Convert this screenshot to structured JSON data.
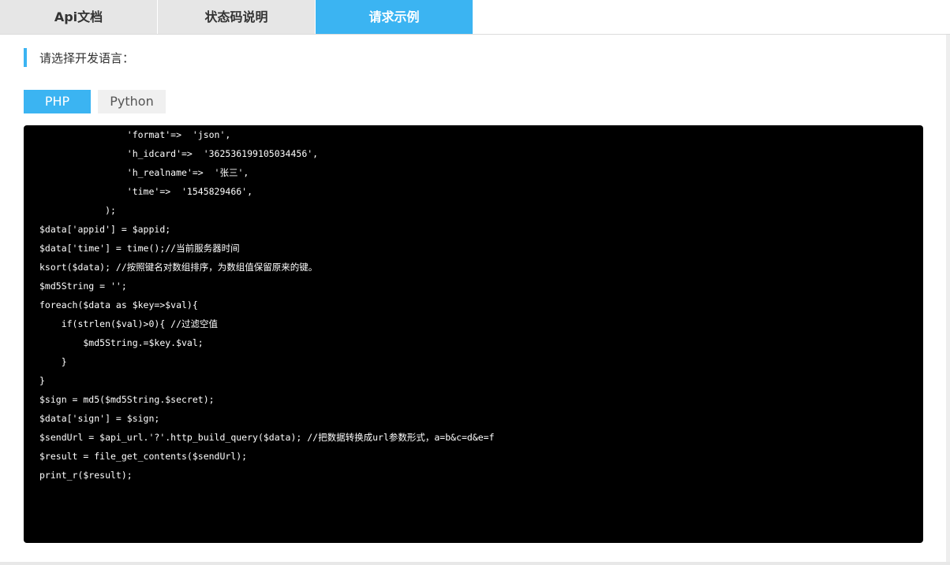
{
  "tabs": [
    {
      "label": "Api文档"
    },
    {
      "label": "状态码说明"
    },
    {
      "label": "请求示例",
      "active": true
    }
  ],
  "section_label": "请选择开发语言：",
  "languages": {
    "php": "PHP",
    "python": "Python",
    "selected": "PHP"
  },
  "code_lines": [
    "                'format'=>  'json',",
    "                'h_idcard'=>  '362536199105034456',",
    "                'h_realname'=>  '张三',",
    "                'time'=>  '1545829466',",
    "            );",
    "$data['appid'] = $appid;",
    "$data['time'] = time();//当前服务器时间",
    "ksort($data); //按照键名对数组排序，为数组值保留原来的键。",
    "$md5String = '';",
    "foreach($data as $key=>$val){",
    "    if(strlen($val)>0){ //过滤空值",
    "        $md5String.=$key.$val;",
    "    }",
    "}",
    "$sign = md5($md5String.$secret);",
    "$data['sign'] = $sign;",
    "$sendUrl = $api_url.'?'.http_build_query($data); //把数据转换成url参数形式，a=b&c=d&e=f",
    "$result = file_get_contents($sendUrl);",
    "print_r($result);"
  ],
  "colors": {
    "accent": "#3bb4f2",
    "code_bg": "#000000",
    "code_text": "#ffffff"
  }
}
